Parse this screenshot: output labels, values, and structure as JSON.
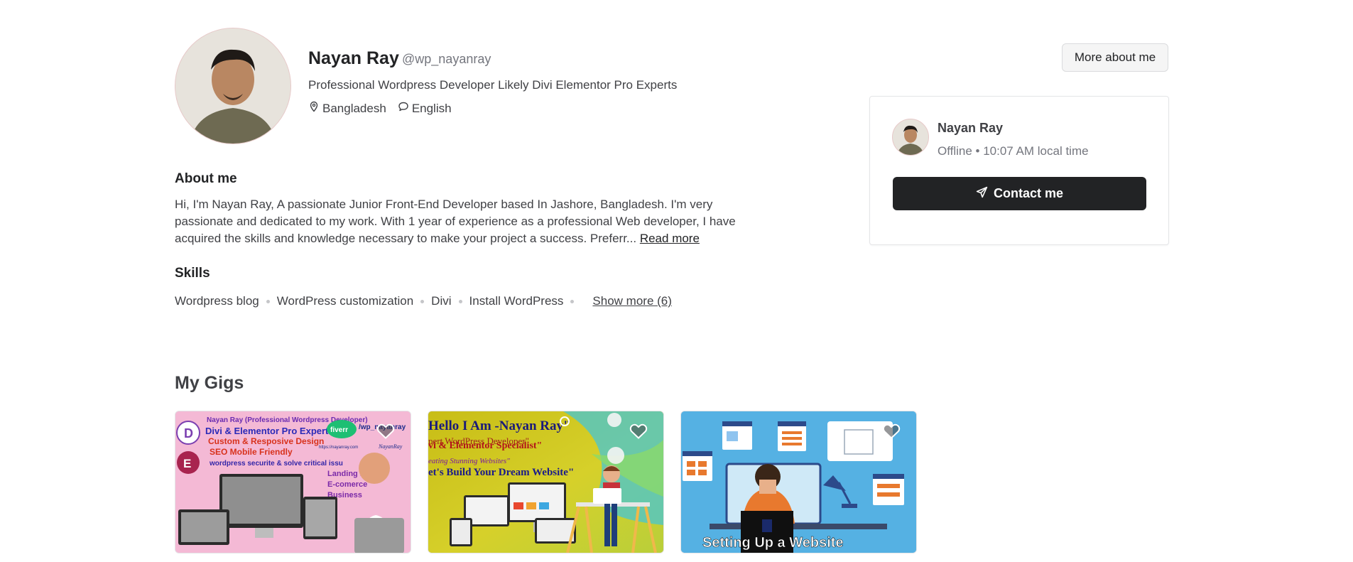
{
  "profile": {
    "name": "Nayan Ray",
    "handle": "@wp_nayanray",
    "tagline": "Professional Wordpress Developer Likely Divi Elementor Pro Experts",
    "location": "Bangladesh",
    "language": "English",
    "more_button": "More about me"
  },
  "contact_card": {
    "name": "Nayan Ray",
    "status": "Offline • 10:07 AM local time",
    "contact_button": "Contact me"
  },
  "about": {
    "heading": "About me",
    "text": "Hi, I'm Nayan Ray, A passionate Junior Front-End Developer based In Jashore, Bangladesh. I'm very passionate and dedicated to my work. With 1 year of experience as a professional Web developer, I have acquired the skills and knowledge necessary to make your project a success. Preferr...",
    "read_more": "Read more"
  },
  "skills": {
    "heading": "Skills",
    "items": [
      "Wordpress blog",
      "WordPress customization",
      "Divi",
      "Install WordPress"
    ],
    "show_more": "Show more (6)"
  },
  "gigs": {
    "heading": "My Gigs",
    "items": [
      {
        "lines": [
          "Nayan Ray (Professional Wordpress Developer)",
          "Divi & Elementor Pro Experts",
          "Custom & Resposive Design",
          "SEO Mobile Friendly",
          "wordpress securite & solve critical issu",
          "Landing Page",
          "E-comerce",
          "Business",
          "fiverr",
          "/wp_nayanray",
          "https://nayanray.com",
          "NayanRay"
        ]
      },
      {
        "lines": [
          "Hello I Am -Nayan Ray\"",
          "pert WordPress Developer\"",
          "vi & Elementor Specialist\"",
          "eating Stunning Websites\"",
          "et's Build Your Dream Website\""
        ]
      },
      {
        "lines": [
          "Setting Up a Website"
        ]
      }
    ]
  },
  "colors": {
    "text_primary": "#222325",
    "text_secondary": "#74767e",
    "button_dark": "#222325",
    "border": "#e4e5e7"
  },
  "icons": [
    "location-pin-icon",
    "chat-bubble-icon",
    "send-icon",
    "heart-icon"
  ]
}
